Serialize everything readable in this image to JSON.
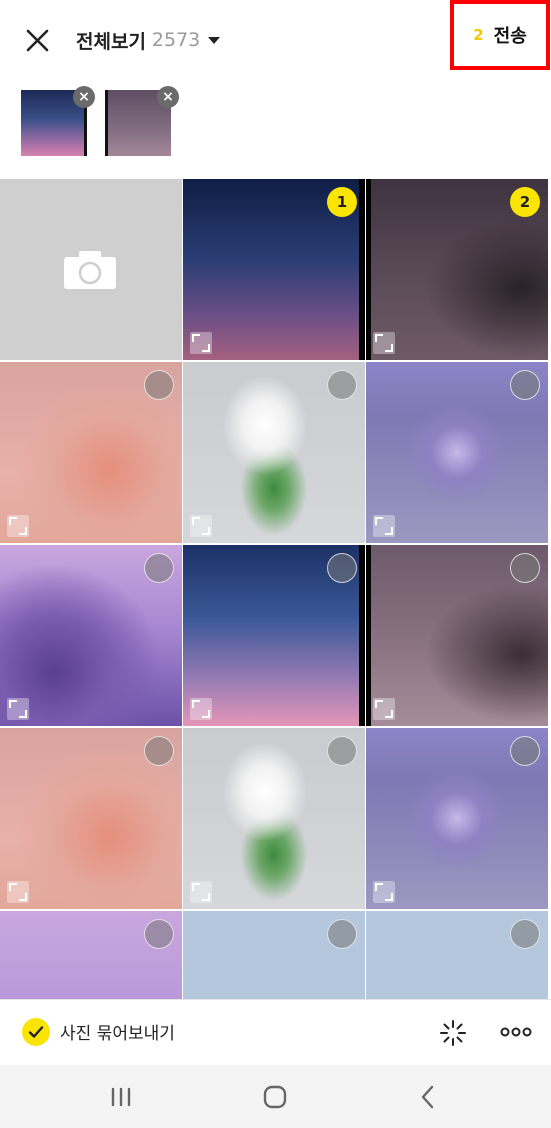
{
  "header": {
    "album_name": "전체보기",
    "photo_count": "2573",
    "send_count": "2",
    "send_label": "전송"
  },
  "selected": [
    {
      "icon": "twilight-gradient-photo",
      "remove": "×"
    },
    {
      "icon": "night-tree-moon-photo",
      "remove": "×"
    }
  ],
  "grid": {
    "selection_numbers": [
      "1",
      "2"
    ]
  },
  "footer": {
    "bundle_label": "사진 묶어보내기"
  },
  "colors": {
    "accent": "#fbe400",
    "highlight_box": "#ff0000"
  }
}
